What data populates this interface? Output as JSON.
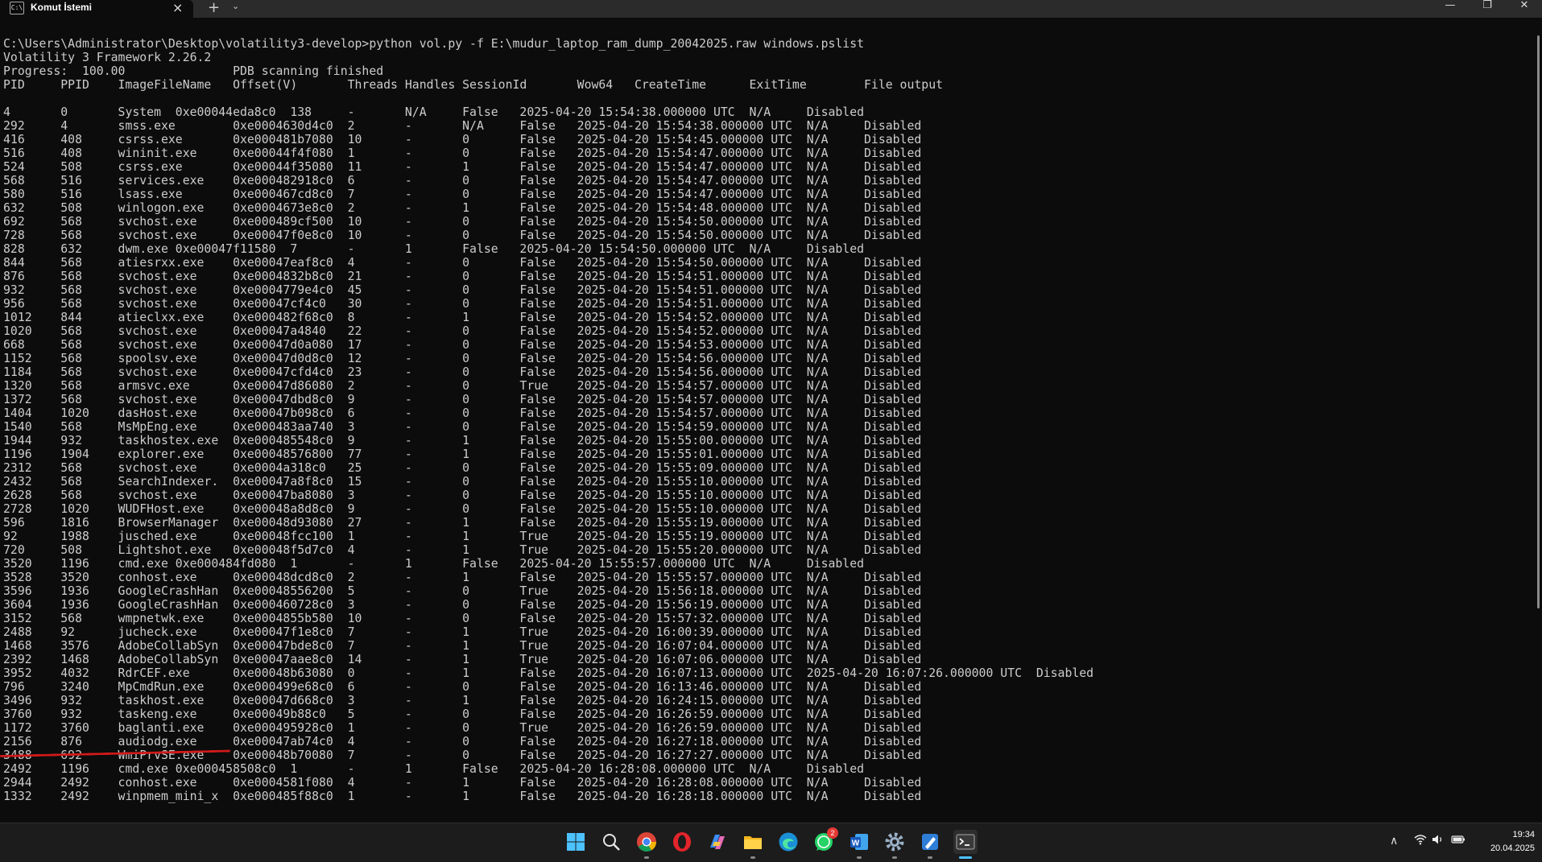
{
  "window": {
    "tab_title": "Komut İstemi",
    "tab_icon_label": "C:\\",
    "tab_close_icon": "close-icon",
    "new_tab_icon": "plus-icon",
    "dropdown_icon": "chevron-down-icon",
    "controls": {
      "minimize": "—",
      "maximize": "❐",
      "close": "✕"
    }
  },
  "terminal": {
    "lines": [
      "C:\\Users\\Administrator\\Desktop\\volatility3-develop>python vol.py -f E:\\mudur_laptop_ram_dump_20042025.raw windows.pslist",
      "Volatility 3 Framework 2.26.2",
      "Progress:  100.00               PDB scanning finished",
      "PID     PPID    ImageFileName   Offset(V)       Threads Handles SessionId       Wow64   CreateTime      ExitTime        File output",
      "",
      "4       0       System  0xe00044eda8c0  138     -       N/A     False   2025-04-20 15:54:38.000000 UTC  N/A     Disabled",
      "292     4       smss.exe        0xe0004630d4c0  2       -       N/A     False   2025-04-20 15:54:38.000000 UTC  N/A     Disabled",
      "416     408     csrss.exe       0xe000481b7080  10      -       0       False   2025-04-20 15:54:45.000000 UTC  N/A     Disabled",
      "516     408     wininit.exe     0xe00044f4f080  1       -       0       False   2025-04-20 15:54:47.000000 UTC  N/A     Disabled",
      "524     508     csrss.exe       0xe00044f35080  11      -       1       False   2025-04-20 15:54:47.000000 UTC  N/A     Disabled",
      "568     516     services.exe    0xe000482918c0  6       -       0       False   2025-04-20 15:54:47.000000 UTC  N/A     Disabled",
      "580     516     lsass.exe       0xe000467cd8c0  7       -       0       False   2025-04-20 15:54:47.000000 UTC  N/A     Disabled",
      "632     508     winlogon.exe    0xe0004673e8c0  2       -       1       False   2025-04-20 15:54:48.000000 UTC  N/A     Disabled",
      "692     568     svchost.exe     0xe000489cf500  10      -       0       False   2025-04-20 15:54:50.000000 UTC  N/A     Disabled",
      "728     568     svchost.exe     0xe00047f0e8c0  10      -       0       False   2025-04-20 15:54:50.000000 UTC  N/A     Disabled",
      "828     632     dwm.exe 0xe00047f11580  7       -       1       False   2025-04-20 15:54:50.000000 UTC  N/A     Disabled",
      "844     568     atiesrxx.exe    0xe00047eaf8c0  4       -       0       False   2025-04-20 15:54:50.000000 UTC  N/A     Disabled",
      "876     568     svchost.exe     0xe0004832b8c0  21      -       0       False   2025-04-20 15:54:51.000000 UTC  N/A     Disabled",
      "932     568     svchost.exe     0xe0004779e4c0  45      -       0       False   2025-04-20 15:54:51.000000 UTC  N/A     Disabled",
      "956     568     svchost.exe     0xe00047cf4c0   30      -       0       False   2025-04-20 15:54:51.000000 UTC  N/A     Disabled",
      "1012    844     atieclxx.exe    0xe000482f68c0  8       -       1       False   2025-04-20 15:54:52.000000 UTC  N/A     Disabled",
      "1020    568     svchost.exe     0xe00047a4840   22      -       0       False   2025-04-20 15:54:52.000000 UTC  N/A     Disabled",
      "668     568     svchost.exe     0xe00047d0a080  17      -       0       False   2025-04-20 15:54:53.000000 UTC  N/A     Disabled",
      "1152    568     spoolsv.exe     0xe00047d0d8c0  12      -       0       False   2025-04-20 15:54:56.000000 UTC  N/A     Disabled",
      "1184    568     svchost.exe     0xe00047cfd4c0  23      -       0       False   2025-04-20 15:54:56.000000 UTC  N/A     Disabled",
      "1320    568     armsvc.exe      0xe00047d86080  2       -       0       True    2025-04-20 15:54:57.000000 UTC  N/A     Disabled",
      "1372    568     svchost.exe     0xe00047dbd8c0  9       -       0       False   2025-04-20 15:54:57.000000 UTC  N/A     Disabled",
      "1404    1020    dasHost.exe     0xe00047b098c0  6       -       0       False   2025-04-20 15:54:57.000000 UTC  N/A     Disabled",
      "1540    568     MsMpEng.exe     0xe000483aa740  3       -       0       False   2025-04-20 15:54:59.000000 UTC  N/A     Disabled",
      "1944    932     taskhostex.exe  0xe000485548c0  9       -       1       False   2025-04-20 15:55:00.000000 UTC  N/A     Disabled",
      "1196    1904    explorer.exe    0xe00048576800  77      -       1       False   2025-04-20 15:55:01.000000 UTC  N/A     Disabled",
      "2312    568     svchost.exe     0xe0004a318c0   25      -       0       False   2025-04-20 15:55:09.000000 UTC  N/A     Disabled",
      "2432    568     SearchIndexer.  0xe00047a8f8c0  15      -       0       False   2025-04-20 15:55:10.000000 UTC  N/A     Disabled",
      "2628    568     svchost.exe     0xe00047ba8080  3       -       0       False   2025-04-20 15:55:10.000000 UTC  N/A     Disabled",
      "2728    1020    WUDFHost.exe    0xe00048a8d8c0  9       -       0       False   2025-04-20 15:55:10.000000 UTC  N/A     Disabled",
      "596     1816    BrowserManager  0xe00048d93080  27      -       1       False   2025-04-20 15:55:19.000000 UTC  N/A     Disabled",
      "92      1988    jusched.exe     0xe00048fcc100  1       -       1       True    2025-04-20 15:55:19.000000 UTC  N/A     Disabled",
      "720     508     Lightshot.exe   0xe00048f5d7c0  4       -       1       True    2025-04-20 15:55:20.000000 UTC  N/A     Disabled",
      "3520    1196    cmd.exe 0xe000484fd080  1       -       1       False   2025-04-20 15:55:57.000000 UTC  N/A     Disabled",
      "3528    3520    conhost.exe     0xe00048dcd8c0  2       -       1       False   2025-04-20 15:55:57.000000 UTC  N/A     Disabled",
      "3596    1936    GoogleCrashHan  0xe00048556200  5       -       0       True    2025-04-20 15:56:18.000000 UTC  N/A     Disabled",
      "3604    1936    GoogleCrashHan  0xe000460728c0  3       -       0       False   2025-04-20 15:56:19.000000 UTC  N/A     Disabled",
      "3152    568     wmpnetwk.exe    0xe0004855b580  10      -       0       False   2025-04-20 15:57:32.000000 UTC  N/A     Disabled",
      "2488    92      jucheck.exe     0xe00047f1e8c0  7       -       1       True    2025-04-20 16:00:39.000000 UTC  N/A     Disabled",
      "1468    3576    AdobeCollabSyn  0xe00047bde8c0  7       -       1       True    2025-04-20 16:07:04.000000 UTC  N/A     Disabled",
      "2392    1468    AdobeCollabSyn  0xe00047aae8c0  14      -       1       True    2025-04-20 16:07:06.000000 UTC  N/A     Disabled",
      "3952    4032    RdrCEF.exe      0xe00048b63080  0       -       1       False   2025-04-20 16:07:13.000000 UTC  2025-04-20 16:07:26.000000 UTC  Disabled",
      "796     3240    MpCmdRun.exe    0xe000499e68c0  6       -       0       False   2025-04-20 16:13:46.000000 UTC  N/A     Disabled",
      "3496    932     taskhost.exe    0xe00047d668c0  3       -       1       False   2025-04-20 16:24:15.000000 UTC  N/A     Disabled",
      "3760    932     taskeng.exe     0xe00049b88c0   5       -       0       False   2025-04-20 16:26:59.000000 UTC  N/A     Disabled",
      "1172    3760    baglanti.exe    0xe000495928c0  1       -       0       True    2025-04-20 16:26:59.000000 UTC  N/A     Disabled",
      "2156    876     audiodg.exe     0xe00047ab74c0  4       -       0       False   2025-04-20 16:27:18.000000 UTC  N/A     Disabled",
      "3488    692     WmiPrvSE.exe    0xe00048b70080  7       -       0       False   2025-04-20 16:27:27.000000 UTC  N/A     Disabled",
      "2492    1196    cmd.exe 0xe000458508c0  1       -       1       False   2025-04-20 16:28:08.000000 UTC  N/A     Disabled",
      "2944    2492    conhost.exe     0xe0004581f080  4       -       1       False   2025-04-20 16:28:08.000000 UTC  N/A     Disabled",
      "1332    2492    winpmem_mini_x  0xe000485f88c0  1       -       1       False   2025-04-20 16:28:18.000000 UTC  N/A     Disabled"
    ],
    "highlight_color": "#d11a1a"
  },
  "taskbar": {
    "icons": {
      "start": "windows-start-icon",
      "search": "search-icon",
      "chrome": "chrome-icon",
      "opera": "opera-icon",
      "copilot": "copilot-icon",
      "explorer": "file-explorer-icon",
      "edge": "edge-icon",
      "whatsapp": "whatsapp-icon",
      "word": "word-icon",
      "settings": "settings-gear-icon",
      "paint": "paint-icon",
      "terminal": "terminal-icon"
    },
    "whatsapp_badge": "2",
    "tray": {
      "chevron": "∧",
      "wifi": "wifi-icon",
      "volume": "volume-icon",
      "battery": "battery-icon"
    },
    "clock_time": "19:34",
    "clock_date": "20.04.2025"
  }
}
